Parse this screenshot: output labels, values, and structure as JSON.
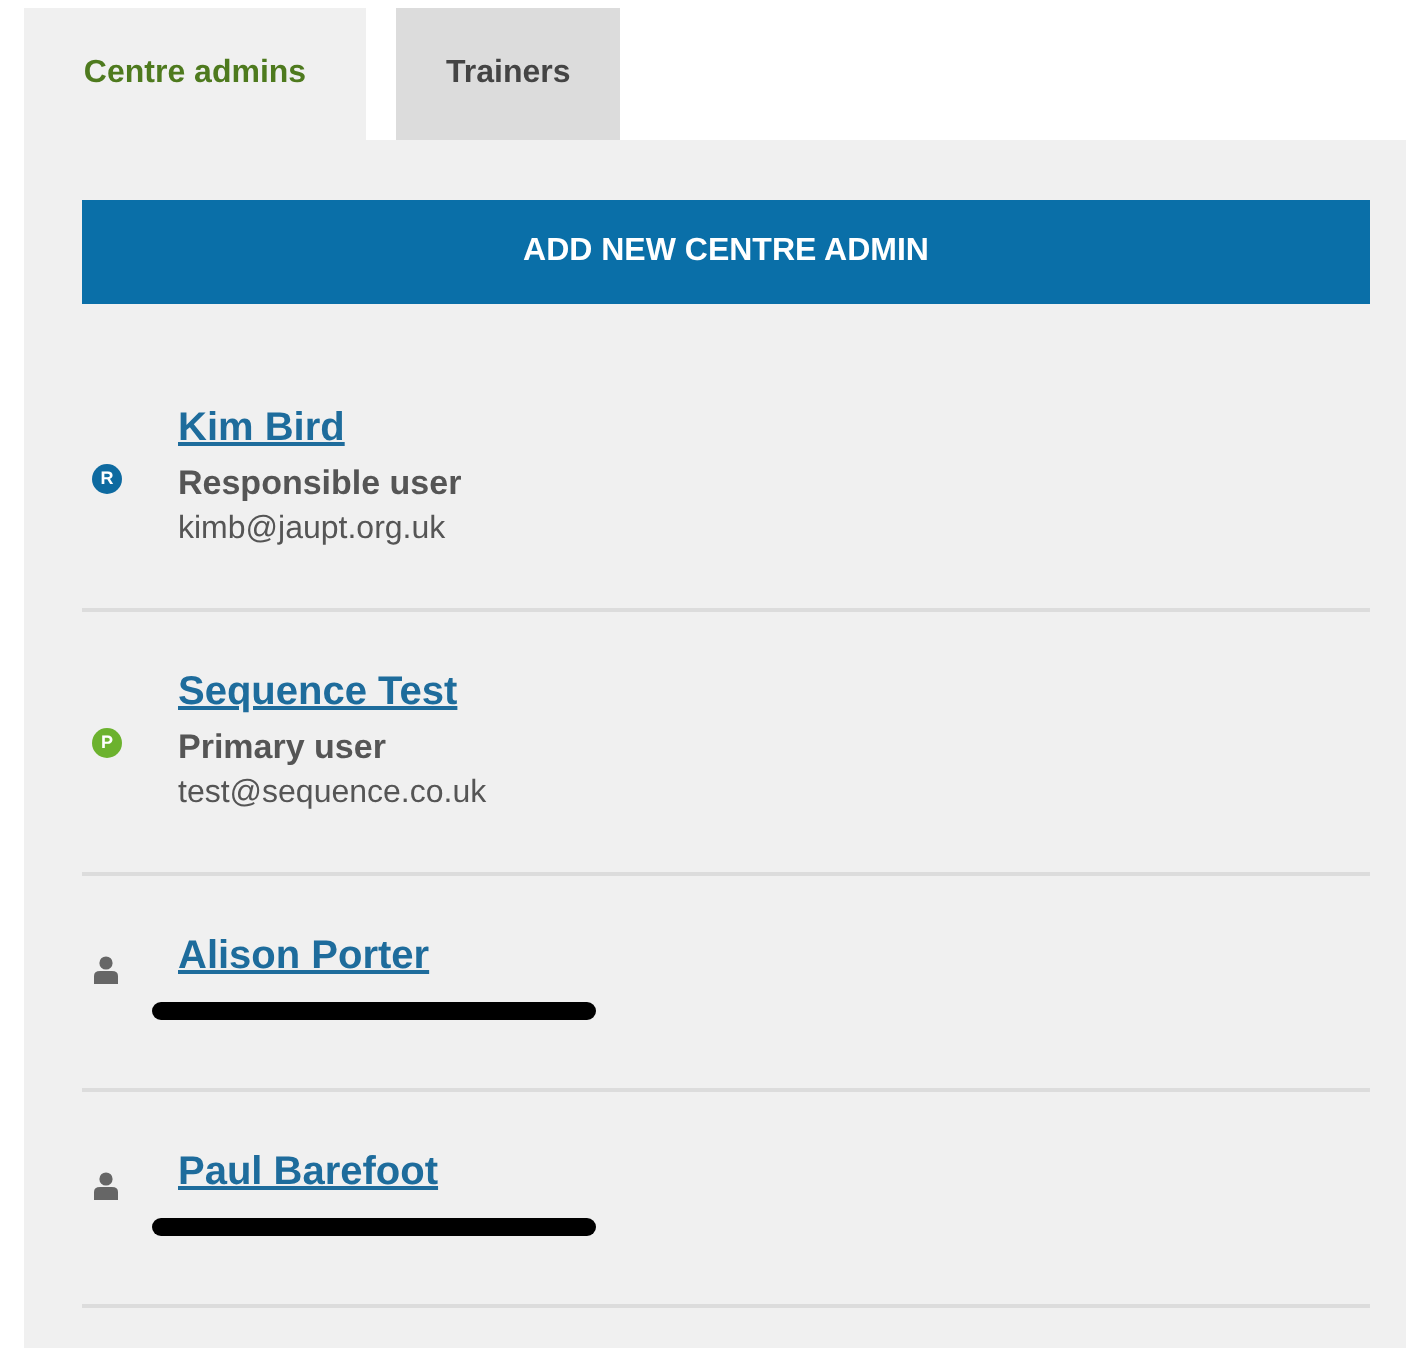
{
  "tabs": [
    {
      "label": "Centre admins",
      "selected": true
    },
    {
      "label": "Trainers",
      "selected": false
    }
  ],
  "add_button": "ADD NEW CENTRE ADMIN",
  "users": [
    {
      "kind": "badge",
      "badge": "R",
      "color": "#0e6aa0",
      "name": "Kim Bird",
      "role": "Responsible user",
      "email": "kimb@jaupt.org.uk",
      "email_redacted": false
    },
    {
      "kind": "badge",
      "badge": "P",
      "color": "#6cb22e",
      "name": "Sequence Test",
      "role": "Primary user",
      "email": "test@sequence.co.uk",
      "email_redacted": false
    },
    {
      "kind": "person",
      "name": "Alison Porter",
      "email_redacted": true
    },
    {
      "kind": "person",
      "name": "Paul Barefoot",
      "email_redacted": true
    }
  ]
}
